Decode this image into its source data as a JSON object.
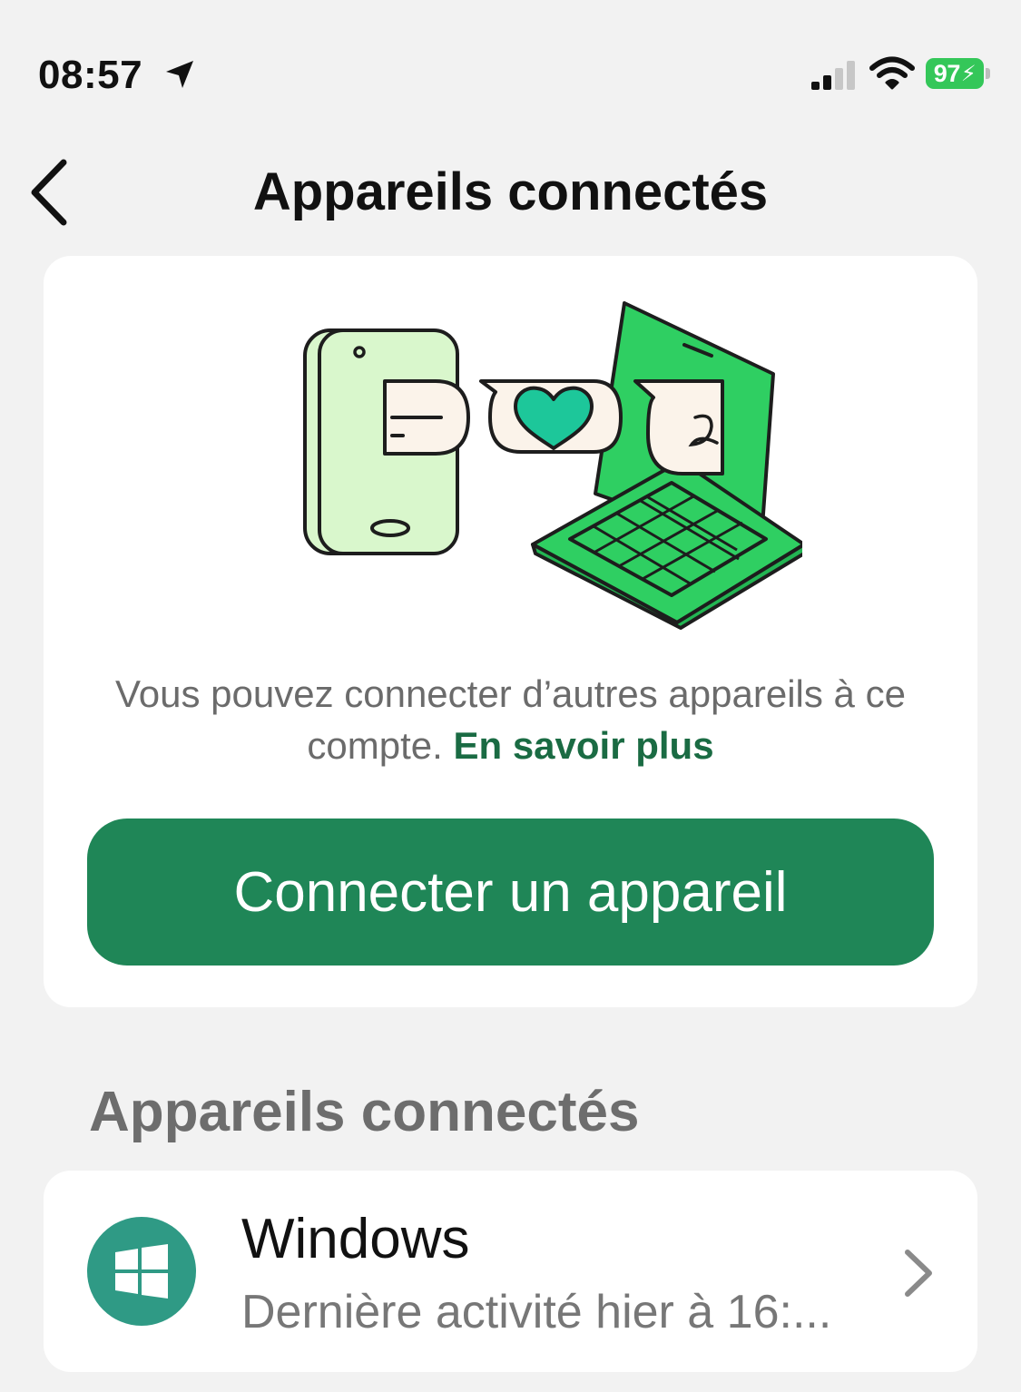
{
  "status_bar": {
    "time": "08:57",
    "battery": "97",
    "icons": [
      "location-arrow-icon",
      "cellular-signal-icon",
      "wifi-icon",
      "battery-charging-icon"
    ]
  },
  "nav": {
    "title": "Appareils connectés",
    "back_icon": "chevron-left-icon"
  },
  "intro": {
    "illustration": "phone-chat-laptop-illustration",
    "text": "Vous pouvez connecter d’autres appareils à ce compte.",
    "link": "En savoir plus",
    "button": "Connecter un appareil"
  },
  "devices_section": {
    "title": "Appareils connectés",
    "items": [
      {
        "name": "Windows",
        "status": "Dernière activité hier à 16:...",
        "icon": "windows-logo-icon"
      }
    ]
  },
  "colors": {
    "background": "#f2f2f2",
    "card": "#ffffff",
    "primary_button": "#1f8657",
    "link": "#1a6b43",
    "battery": "#34c759",
    "device_avatar": "#2f9a85"
  }
}
